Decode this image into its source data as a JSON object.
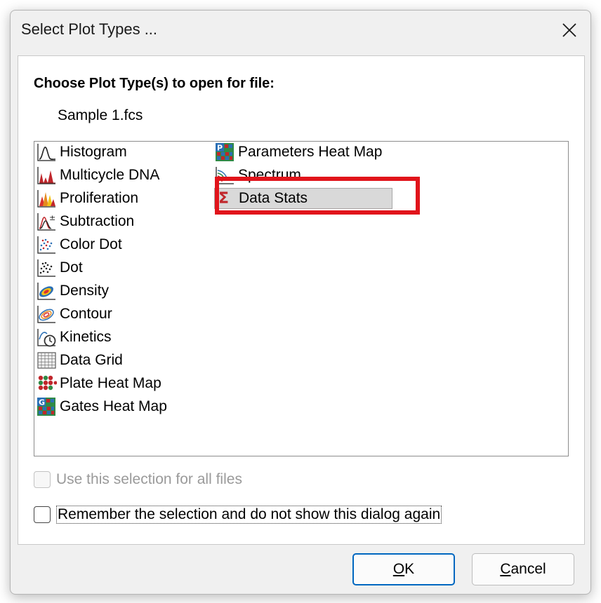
{
  "dialog": {
    "title": "Select Plot Types ...",
    "heading": "Choose Plot Type(s) to open for file:",
    "file_name": "Sample 1.fcs"
  },
  "plot_types": {
    "col1": [
      {
        "label": "Histogram",
        "icon": "histogram-icon"
      },
      {
        "label": "Multicycle DNA",
        "icon": "multicycle-dna-icon"
      },
      {
        "label": "Proliferation",
        "icon": "proliferation-icon"
      },
      {
        "label": "Subtraction",
        "icon": "subtraction-icon"
      },
      {
        "label": "Color Dot",
        "icon": "color-dot-icon"
      },
      {
        "label": "Dot",
        "icon": "dot-icon"
      },
      {
        "label": "Density",
        "icon": "density-icon"
      },
      {
        "label": "Contour",
        "icon": "contour-icon"
      },
      {
        "label": "Kinetics",
        "icon": "kinetics-icon"
      },
      {
        "label": "Data Grid",
        "icon": "data-grid-icon"
      },
      {
        "label": "Plate Heat Map",
        "icon": "plate-heat-map-icon"
      },
      {
        "label": "Gates Heat Map",
        "icon": "gates-heat-map-icon"
      }
    ],
    "col2": [
      {
        "label": "Parameters Heat Map",
        "icon": "parameters-heat-map-icon"
      },
      {
        "label": "Spectrum",
        "icon": "spectrum-icon"
      },
      {
        "label": "Data Stats",
        "icon": "sigma-icon",
        "selected": true
      }
    ],
    "selected": "Data Stats"
  },
  "options": {
    "use_for_all": {
      "label": "Use this selection for all files",
      "checked": false,
      "enabled": false
    },
    "remember": {
      "label": "Remember the selection and do not show this dialog again",
      "checked": false,
      "enabled": true
    }
  },
  "buttons": {
    "ok": {
      "mnemonic": "O",
      "rest": "K"
    },
    "cancel": {
      "mnemonic": "C",
      "rest": "ancel"
    }
  },
  "colors": {
    "annotation_red": "#e1141b",
    "default_button_border": "#0067c0"
  }
}
